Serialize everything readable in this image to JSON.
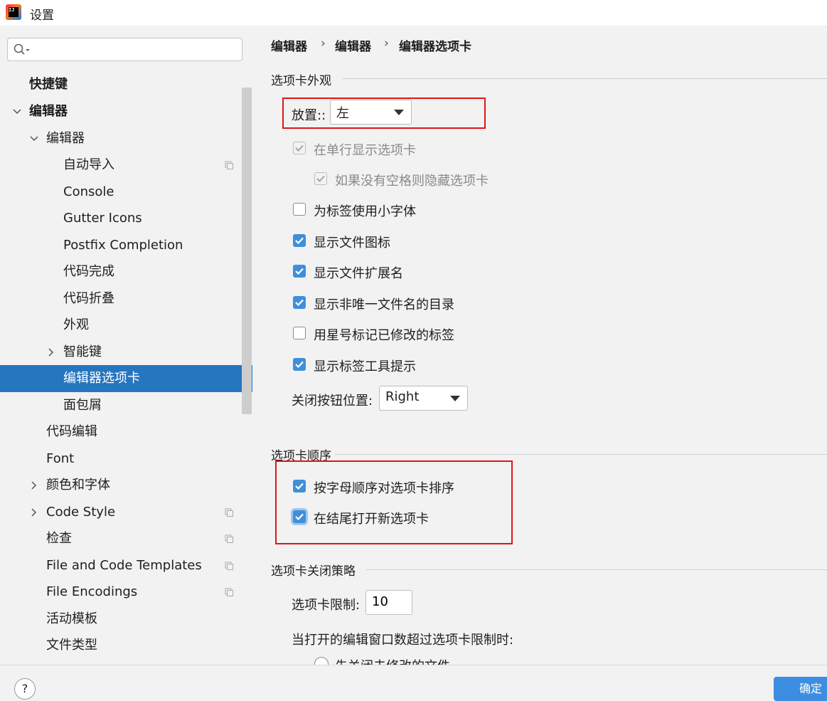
{
  "window": {
    "title": "设置",
    "app_icon": "intellij-idea-icon"
  },
  "search": {
    "value": "",
    "placeholder": ""
  },
  "sidebar": {
    "items": [
      {
        "label": "快捷键"
      },
      {
        "label": "编辑器"
      },
      {
        "label": "编辑器"
      },
      {
        "label": "自动导入"
      },
      {
        "label": "Console"
      },
      {
        "label": "Gutter Icons"
      },
      {
        "label": "Postfix Completion"
      },
      {
        "label": "代码完成"
      },
      {
        "label": "代码折叠"
      },
      {
        "label": "外观"
      },
      {
        "label": "智能键"
      },
      {
        "label": "编辑器选项卡"
      },
      {
        "label": "面包屑"
      },
      {
        "label": "代码编辑"
      },
      {
        "label": "Font"
      },
      {
        "label": "颜色和字体"
      },
      {
        "label": "Code Style"
      },
      {
        "label": "检查"
      },
      {
        "label": "File and Code Templates"
      },
      {
        "label": "File Encodings"
      },
      {
        "label": "活动模板"
      },
      {
        "label": "文件类型"
      }
    ],
    "selected": "编辑器选项卡"
  },
  "breadcrumb": {
    "part1": "编辑器",
    "part2": "编辑器",
    "part3": "编辑器选项卡",
    "separator": "›"
  },
  "appearance": {
    "title": "选项卡外观",
    "placement_label": "放置::",
    "placement_value": "左",
    "single_row": {
      "label": "在单行显示选项卡",
      "checked": true,
      "enabled": false
    },
    "hide_if_no_space": {
      "label": "如果没有空格则隐藏选项卡",
      "checked": true,
      "enabled": false
    },
    "small_font": {
      "label": "为标签使用小字体",
      "checked": false
    },
    "show_file_icon": {
      "label": "显示文件图标",
      "checked": true
    },
    "show_extension": {
      "label": "显示文件扩展名",
      "checked": true
    },
    "show_dir": {
      "label": "显示非唯一文件名的目录",
      "checked": true
    },
    "mark_modified": {
      "label": "用星号标记已修改的标签",
      "checked": false
    },
    "show_tooltips": {
      "label": "显示标签工具提示",
      "checked": true
    },
    "close_button_label": "关闭按钮位置:",
    "close_button_value": "Right"
  },
  "order": {
    "title": "选项卡顺序",
    "sort_alpha": {
      "label": "按字母顺序对选项卡排序",
      "checked": true
    },
    "open_at_end": {
      "label": "在结尾打开新选项卡",
      "checked": true
    }
  },
  "closing": {
    "title": "选项卡关闭策略",
    "limit_label": "选项卡限制:",
    "limit_value": "10",
    "exceed_label": "当打开的编辑窗口数超过选项卡限制时:",
    "radio_partial": "先关闭未修改的文件"
  },
  "footer": {
    "help": "?",
    "ok_label": "确定"
  },
  "colors": {
    "accent": "#2675bf",
    "checkbox": "#3f8fd9",
    "annotation": "#e01515"
  }
}
